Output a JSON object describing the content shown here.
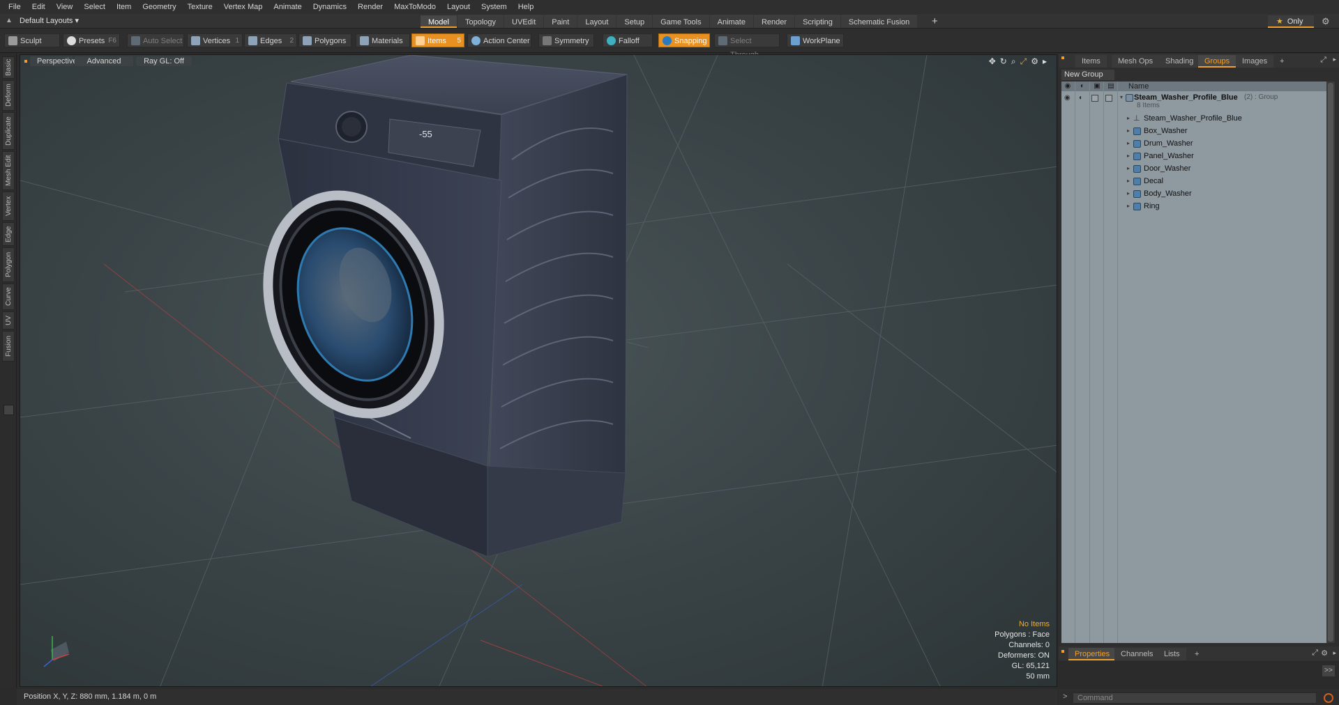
{
  "menubar": {
    "items": [
      "File",
      "Edit",
      "View",
      "Select",
      "Item",
      "Geometry",
      "Texture",
      "Vertex Map",
      "Animate",
      "Dynamics",
      "Render",
      "MaxToModo",
      "Layout",
      "System",
      "Help"
    ]
  },
  "layoutbar": {
    "layout_select": "Default Layouts ▾",
    "tabs": [
      "Model",
      "Topology",
      "UVEdit",
      "Paint",
      "Layout",
      "Setup",
      "Game Tools",
      "Animate",
      "Render",
      "Scripting",
      "Schematic Fusion"
    ],
    "active_tab": "Model",
    "add_tab": "+",
    "only_label": "Only"
  },
  "toolbar": {
    "sculpt": "Sculpt",
    "presets": "Presets",
    "presets_key": "F6",
    "auto_select": "Auto Select",
    "vertices": "Vertices",
    "vertices_key": "1",
    "edges": "Edges",
    "edges_key": "2",
    "polygons": "Polygons",
    "materials": "Materials",
    "items": "Items",
    "items_key": "5",
    "action_center": "Action Center",
    "symmetry": "Symmetry",
    "falloff": "Falloff",
    "snapping": "Snapping",
    "select_through": "Select Through",
    "workplane": "WorkPlane"
  },
  "lefttabs": [
    "Basic",
    "Deform",
    "Duplicate",
    "Mesh Edit",
    "Vertex",
    "Edge",
    "Polygon",
    "Curve",
    "UV",
    "Fusion"
  ],
  "viewport": {
    "view_mode": "Perspective",
    "shading": "Advanced",
    "raygl": "Ray GL: Off",
    "info": {
      "selection": "No Items",
      "polygons": "Polygons : Face",
      "channels": "Channels: 0",
      "deformers": "Deformers: ON",
      "gl": "GL: 65,121",
      "focal": "50 mm"
    },
    "display_readout": "-55"
  },
  "statusbar": {
    "position": "Position X, Y, Z:   880 mm, 1.184 m, 0 m"
  },
  "rightpanel": {
    "tabs": [
      "Items",
      "Mesh Ops",
      "Shading",
      "Groups",
      "Images"
    ],
    "active_tab": "Groups",
    "add_tab": "+",
    "new_group": "New Group",
    "name_header": "Name",
    "group": {
      "name": "Steam_Washer_Profile_Blue",
      "suffix": "(2) : Group",
      "count": "8 Items"
    },
    "items": [
      "Steam_Washer_Profile_Blue",
      "Box_Washer",
      "Drum_Washer",
      "Panel_Washer",
      "Door_Washer",
      "Decal",
      "Body_Washer",
      "Ring"
    ],
    "props_tabs": [
      "Properties",
      "Channels",
      "Lists"
    ],
    "props_active": "Properties",
    "props_add": "+",
    "props_arrow": ">>",
    "command_prompt": ">",
    "command_placeholder": "Command"
  },
  "colors": {
    "accent": "#f0a030",
    "list_bg": "#8f99a0",
    "viewport_bg": "#3a4447"
  }
}
